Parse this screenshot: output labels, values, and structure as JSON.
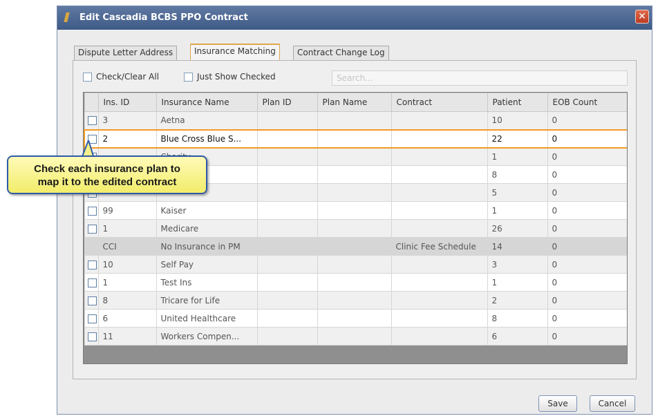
{
  "window": {
    "title": "Edit Cascadia BCBS PPO Contract",
    "close_label": "✕"
  },
  "tabs": [
    {
      "label": "Dispute Letter Address"
    },
    {
      "label": "Insurance Matching"
    },
    {
      "label": "Contract Change Log"
    }
  ],
  "active_tab": "Insurance Matching",
  "toolbar": {
    "check_clear_all_label": "Check/Clear All",
    "just_show_checked_label": "Just Show Checked",
    "search_placeholder": "Search..."
  },
  "table": {
    "columns": [
      "",
      "Ins. ID",
      "Insurance Name",
      "Plan ID",
      "Plan Name",
      "Contract",
      "Patient",
      "EOB Count"
    ],
    "rows": [
      {
        "checkbox": true,
        "ins_id": "3",
        "name": "Aetna",
        "plan_id": "",
        "plan_name": "",
        "contract": "",
        "patient": "10",
        "eob": "0"
      },
      {
        "checkbox": true,
        "ins_id": "2",
        "name": "Blue Cross Blue S...",
        "plan_id": "",
        "plan_name": "",
        "contract": "",
        "patient": "22",
        "eob": "0",
        "highlighted": true
      },
      {
        "checkbox": true,
        "ins_id": "",
        "name": "Charity",
        "plan_id": "",
        "plan_name": "",
        "contract": "",
        "patient": "1",
        "eob": "0"
      },
      {
        "checkbox": true,
        "ins_id": "",
        "name": "",
        "plan_id": "",
        "plan_name": "",
        "contract": "",
        "patient": "8",
        "eob": "0"
      },
      {
        "checkbox": true,
        "ins_id": "",
        "name": "",
        "plan_id": "",
        "plan_name": "",
        "contract": "",
        "patient": "5",
        "eob": "0"
      },
      {
        "checkbox": true,
        "ins_id": "99",
        "name": "Kaiser",
        "plan_id": "",
        "plan_name": "",
        "contract": "",
        "patient": "1",
        "eob": "0"
      },
      {
        "checkbox": true,
        "ins_id": "1",
        "name": "Medicare",
        "plan_id": "",
        "plan_name": "",
        "contract": "",
        "patient": "26",
        "eob": "0"
      },
      {
        "checkbox": false,
        "ins_id": "CCI",
        "name": "No Insurance in PM",
        "plan_id": "",
        "plan_name": "",
        "contract": "Clinic Fee Schedule",
        "patient": "14",
        "eob": "0",
        "gray": true
      },
      {
        "checkbox": true,
        "ins_id": "10",
        "name": "Self Pay",
        "plan_id": "",
        "plan_name": "",
        "contract": "",
        "patient": "3",
        "eob": "0"
      },
      {
        "checkbox": true,
        "ins_id": "1",
        "name": "Test Ins",
        "plan_id": "",
        "plan_name": "",
        "contract": "",
        "patient": "1",
        "eob": "0"
      },
      {
        "checkbox": true,
        "ins_id": "8",
        "name": "Tricare for Life",
        "plan_id": "",
        "plan_name": "",
        "contract": "",
        "patient": "2",
        "eob": "0"
      },
      {
        "checkbox": true,
        "ins_id": "6",
        "name": "United Healthcare",
        "plan_id": "",
        "plan_name": "",
        "contract": "",
        "patient": "8",
        "eob": "0"
      },
      {
        "checkbox": true,
        "ins_id": "11",
        "name": "Workers Compen...",
        "plan_id": "",
        "plan_name": "",
        "contract": "",
        "patient": "6",
        "eob": "0"
      }
    ]
  },
  "callout": {
    "line1": "Check each insurance plan to",
    "line2": "map it to the edited contract"
  },
  "buttons": {
    "save": "Save",
    "cancel": "Cancel"
  },
  "colors": {
    "highlight": "#f29a22",
    "titlebar": "#4b6894",
    "callout": "#f6f08a",
    "callout_border": "#2f5aa8"
  }
}
